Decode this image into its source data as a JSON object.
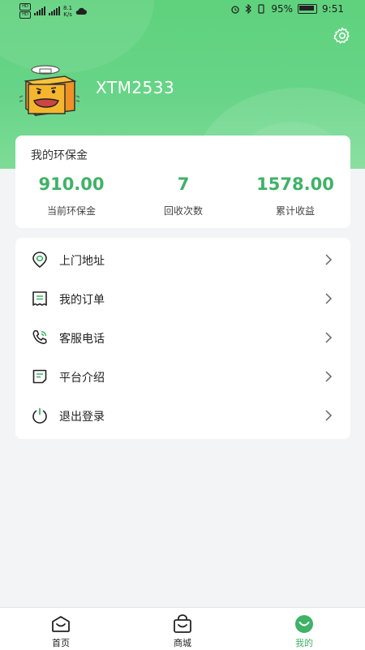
{
  "status_bar": {
    "battery": "95%",
    "time": "9:51",
    "network_speed": "8.1",
    "network_unit": "K/s"
  },
  "user": {
    "name": "XTM2533"
  },
  "env_card": {
    "title": "我的环保金",
    "stats": [
      {
        "value": "910.00",
        "label": "当前环保金"
      },
      {
        "value": "7",
        "label": "回收次数"
      },
      {
        "value": "1578.00",
        "label": "累计收益"
      }
    ]
  },
  "menu": [
    {
      "label": "上门地址",
      "icon": "location-icon"
    },
    {
      "label": "我的订单",
      "icon": "order-icon"
    },
    {
      "label": "客服电话",
      "icon": "phone-icon"
    },
    {
      "label": "平台介绍",
      "icon": "document-icon"
    },
    {
      "label": "退出登录",
      "icon": "power-icon"
    }
  ],
  "bottom_nav": [
    {
      "label": "首页",
      "icon": "home-icon",
      "active": false
    },
    {
      "label": "商城",
      "icon": "shop-bag-icon",
      "active": false
    },
    {
      "label": "我的",
      "icon": "profile-smile-icon",
      "active": true
    }
  ],
  "colors": {
    "accent": "#3fb268",
    "header": "#67d487",
    "background": "#f3f4f6"
  }
}
